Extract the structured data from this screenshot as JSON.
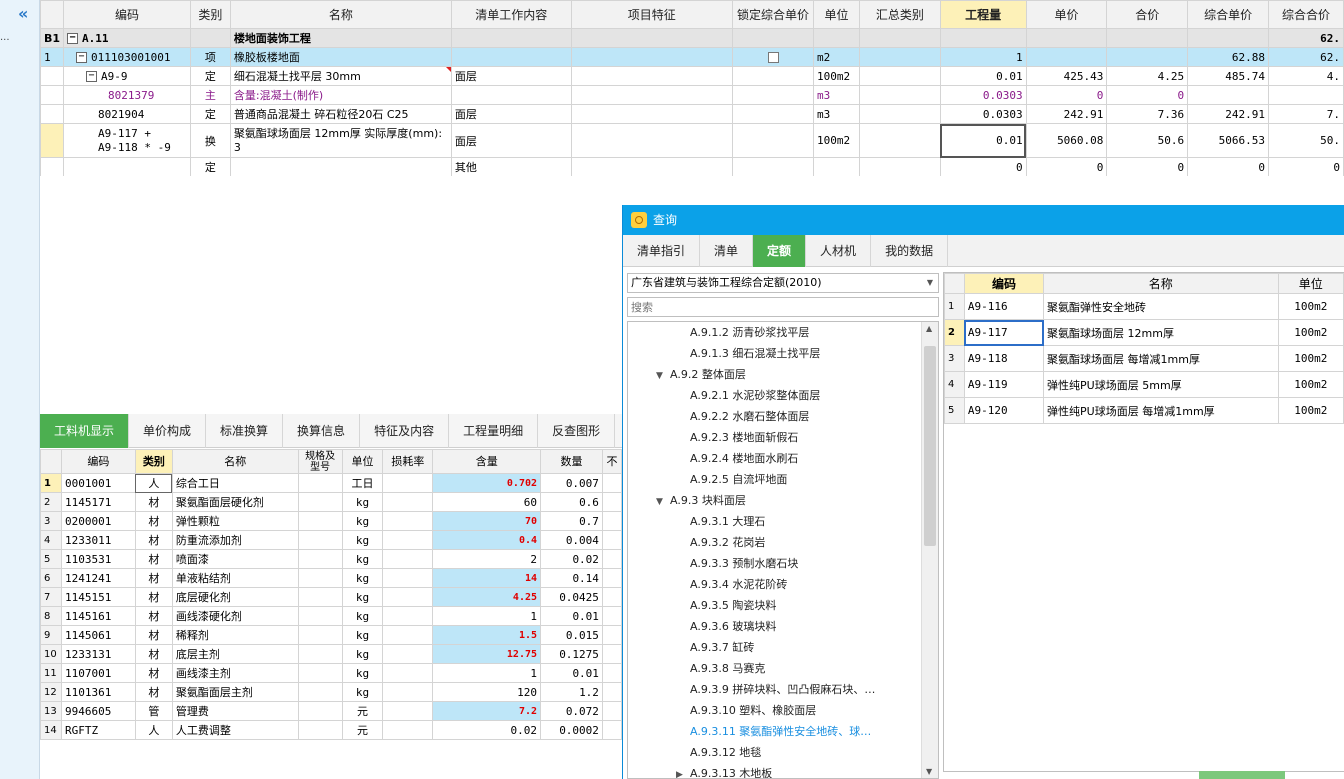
{
  "left_bar": {
    "collapse_icon": "double-chevron-left-icon",
    "dots": "..."
  },
  "top_grid": {
    "headers": [
      "",
      "编码",
      "类别",
      "名称",
      "清单工作内容",
      "项目特征",
      "锁定综合单价",
      "单位",
      "汇总类别",
      "工程量",
      "单价",
      "合价",
      "综合单价",
      "综合合价"
    ],
    "rows": [
      {
        "idx": "B1",
        "code": "A.11",
        "type": "",
        "name": "楼地面装饰工程",
        "work": "",
        "unit": "",
        "qty": "",
        "price": "",
        "total": "",
        "comp_price": "",
        "comp_total": "62."
      },
      {
        "idx": "1",
        "code": "011103001001",
        "type": "项",
        "name": "橡胶板楼地面",
        "work": "",
        "unit": "m2",
        "qty": "1",
        "price": "",
        "total": "",
        "comp_price": "62.88",
        "comp_total": "62."
      },
      {
        "idx": "",
        "code": "A9-9",
        "type": "定",
        "name": "细石混凝土找平层 30mm",
        "work": "面层",
        "unit": "100m2",
        "qty": "0.01",
        "price": "425.43",
        "total": "4.25",
        "comp_price": "485.74",
        "comp_total": "4."
      },
      {
        "idx": "",
        "code": "8021379",
        "type": "主",
        "name": "含量:混凝土(制作)",
        "work": "",
        "unit": "m3",
        "qty": "0.0303",
        "price": "0",
        "total": "0",
        "comp_price": "",
        "comp_total": ""
      },
      {
        "idx": "",
        "code": "8021904",
        "type": "定",
        "name": "普通商品混凝土 碎石粒径20石 C25",
        "work": "面层",
        "unit": "m3",
        "qty": "0.0303",
        "price": "242.91",
        "total": "7.36",
        "comp_price": "242.91",
        "comp_total": "7."
      },
      {
        "idx": "",
        "code": "A9-117 +",
        "code2": "A9-118 * -9",
        "type": "换",
        "name": "聚氨酯球场面层 12mm厚  实际厚度(mm):",
        "name2": "3",
        "work": "面层",
        "unit": "100m2",
        "qty": "0.01",
        "price": "5060.08",
        "total": "50.6",
        "comp_price": "5066.53",
        "comp_total": "50."
      },
      {
        "idx": "",
        "code": "",
        "type": "定",
        "name": "",
        "work": "其他",
        "unit": "",
        "qty": "0",
        "price": "0",
        "total": "0",
        "comp_price": "0",
        "comp_total": "0"
      }
    ]
  },
  "bottom_tabs": [
    "工料机显示",
    "单价构成",
    "标准换算",
    "换算信息",
    "特征及内容",
    "工程量明细",
    "反查图形"
  ],
  "bottom_grid": {
    "headers": [
      "",
      "编码",
      "类别",
      "名称",
      "规格及型号",
      "单位",
      "损耗率",
      "含量",
      "数量",
      "不"
    ],
    "rows": [
      {
        "n": "1",
        "code": "0001001",
        "type": "人",
        "name": "综合工日",
        "unit": "工日",
        "content": "0.702",
        "qty": "0.007",
        "hl": true
      },
      {
        "n": "2",
        "code": "1145171",
        "type": "材",
        "name": "聚氨酯面层硬化剂",
        "unit": "kg",
        "content": "60",
        "qty": "0.6",
        "hl": false
      },
      {
        "n": "3",
        "code": "0200001",
        "type": "材",
        "name": "弹性颗粒",
        "unit": "kg",
        "content": "70",
        "qty": "0.7",
        "hl": true
      },
      {
        "n": "4",
        "code": "1233011",
        "type": "材",
        "name": "防重流添加剂",
        "unit": "kg",
        "content": "0.4",
        "qty": "0.004",
        "hl": true
      },
      {
        "n": "5",
        "code": "1103531",
        "type": "材",
        "name": "喷面漆",
        "unit": "kg",
        "content": "2",
        "qty": "0.02",
        "hl": false
      },
      {
        "n": "6",
        "code": "1241241",
        "type": "材",
        "name": "单液粘结剂",
        "unit": "kg",
        "content": "14",
        "qty": "0.14",
        "hl": true
      },
      {
        "n": "7",
        "code": "1145151",
        "type": "材",
        "name": "底层硬化剂",
        "unit": "kg",
        "content": "4.25",
        "qty": "0.0425",
        "hl": true
      },
      {
        "n": "8",
        "code": "1145161",
        "type": "材",
        "name": "画线漆硬化剂",
        "unit": "kg",
        "content": "1",
        "qty": "0.01",
        "hl": false
      },
      {
        "n": "9",
        "code": "1145061",
        "type": "材",
        "name": "稀释剂",
        "unit": "kg",
        "content": "1.5",
        "qty": "0.015",
        "hl": true
      },
      {
        "n": "10",
        "code": "1233131",
        "type": "材",
        "name": "底层主剂",
        "unit": "kg",
        "content": "12.75",
        "qty": "0.1275",
        "hl": true
      },
      {
        "n": "11",
        "code": "1107001",
        "type": "材",
        "name": "画线漆主剂",
        "unit": "kg",
        "content": "1",
        "qty": "0.01",
        "hl": false
      },
      {
        "n": "12",
        "code": "1101361",
        "type": "材",
        "name": "聚氨酯面层主剂",
        "unit": "kg",
        "content": "120",
        "qty": "1.2",
        "hl": false
      },
      {
        "n": "13",
        "code": "9946605",
        "type": "管",
        "name": "管理费",
        "unit": "元",
        "content": "7.2",
        "qty": "0.072",
        "hl": true
      },
      {
        "n": "14",
        "code": "RGFTZ",
        "type": "人",
        "name": "人工费调整",
        "unit": "元",
        "content": "0.02",
        "qty": "0.0002",
        "hl": false
      }
    ]
  },
  "dialog": {
    "title": "查询",
    "tabs": [
      "清单指引",
      "清单",
      "定额",
      "人材机",
      "我的数据"
    ],
    "library": "广东省建筑与装饰工程综合定额(2010)",
    "search_placeholder": "搜索",
    "tree": [
      {
        "label": "A.9.1.2 沥青砂浆找平层",
        "level": 2
      },
      {
        "label": "A.9.1.3 细石混凝土找平层",
        "level": 2
      },
      {
        "label": "A.9.2 整体面层",
        "level": 1,
        "toggle": "expanded"
      },
      {
        "label": "A.9.2.1 水泥砂浆整体面层",
        "level": 2
      },
      {
        "label": "A.9.2.2 水磨石整体面层",
        "level": 2
      },
      {
        "label": "A.9.2.3 楼地面斩假石",
        "level": 2
      },
      {
        "label": "A.9.2.4 楼地面水刷石",
        "level": 2
      },
      {
        "label": "A.9.2.5 自流坪地面",
        "level": 2
      },
      {
        "label": "A.9.3 块料面层",
        "level": 1,
        "toggle": "expanded"
      },
      {
        "label": "A.9.3.1 大理石",
        "level": 2
      },
      {
        "label": "A.9.3.2 花岗岩",
        "level": 2
      },
      {
        "label": "A.9.3.3 预制水磨石块",
        "level": 2
      },
      {
        "label": "A.9.3.4 水泥花阶砖",
        "level": 2
      },
      {
        "label": "A.9.3.5 陶瓷块料",
        "level": 2
      },
      {
        "label": "A.9.3.6 玻璃块料",
        "level": 2
      },
      {
        "label": "A.9.3.7 缸砖",
        "level": 2
      },
      {
        "label": "A.9.3.8 马赛克",
        "level": 2
      },
      {
        "label": "A.9.3.9 拼碎块料、凹凸假麻石块、…",
        "level": 2
      },
      {
        "label": "A.9.3.10 塑料、橡胶面层",
        "level": 2
      },
      {
        "label": "A.9.3.11 聚氨酯弹性安全地砖、球…",
        "level": 2,
        "selected": true
      },
      {
        "label": "A.9.3.12 地毯",
        "level": 2
      },
      {
        "label": "A.9.3.13 木地板",
        "level": 2,
        "toggle": "collapsed"
      }
    ],
    "result_headers": [
      "",
      "编码",
      "名称",
      "单位"
    ],
    "results": [
      {
        "n": "1",
        "code": "A9-116",
        "name": "聚氨酯弹性安全地砖",
        "unit": "100m2"
      },
      {
        "n": "2",
        "code": "A9-117",
        "name": "聚氨酯球场面层 12mm厚",
        "unit": "100m2"
      },
      {
        "n": "3",
        "code": "A9-118",
        "name": "聚氨酯球场面层 每增减1mm厚",
        "unit": "100m2"
      },
      {
        "n": "4",
        "code": "A9-119",
        "name": "弹性纯PU球场面层 5mm厚",
        "unit": "100m2"
      },
      {
        "n": "5",
        "code": "A9-120",
        "name": "弹性纯PU球场面层 每增减1mm厚",
        "unit": "100m2"
      }
    ]
  },
  "colors": {
    "accent_green": "#4caf50",
    "dialog_blue": "#0ba1e8",
    "highlight_cyan": "#bee6f8",
    "selected_yellow": "#fdf1b8",
    "value_red": "#e00000"
  }
}
